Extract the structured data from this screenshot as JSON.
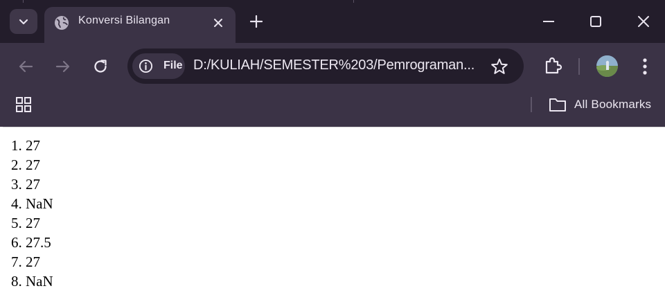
{
  "tab": {
    "title": "Konversi Bilangan"
  },
  "address_bar": {
    "scheme_label": "File",
    "url": "D:/KULIAH/SEMESTER%203/Pemrograman..."
  },
  "bookmarks_bar": {
    "all_bookmarks_label": "All Bookmarks"
  },
  "page": {
    "lines": [
      "1. 27",
      "2. 27",
      "3. 27",
      "4. NaN",
      "5. 27",
      "6. 27.5",
      "7. 27",
      "8. NaN"
    ]
  },
  "icons": [
    "chevron-down-icon",
    "globe-icon",
    "close-icon",
    "plus-icon",
    "minimize-icon",
    "maximize-icon",
    "window-close-icon",
    "back-arrow-icon",
    "forward-arrow-icon",
    "reload-icon",
    "info-icon",
    "star-icon",
    "extensions-icon",
    "avatar",
    "more-vert-icon",
    "apps-grid-icon",
    "folder-icon"
  ],
  "colors": {
    "tabstrip": "#231d2b",
    "toolbar": "#3b3346",
    "omnibox": "#231d2b",
    "text": "#ece7f1"
  }
}
